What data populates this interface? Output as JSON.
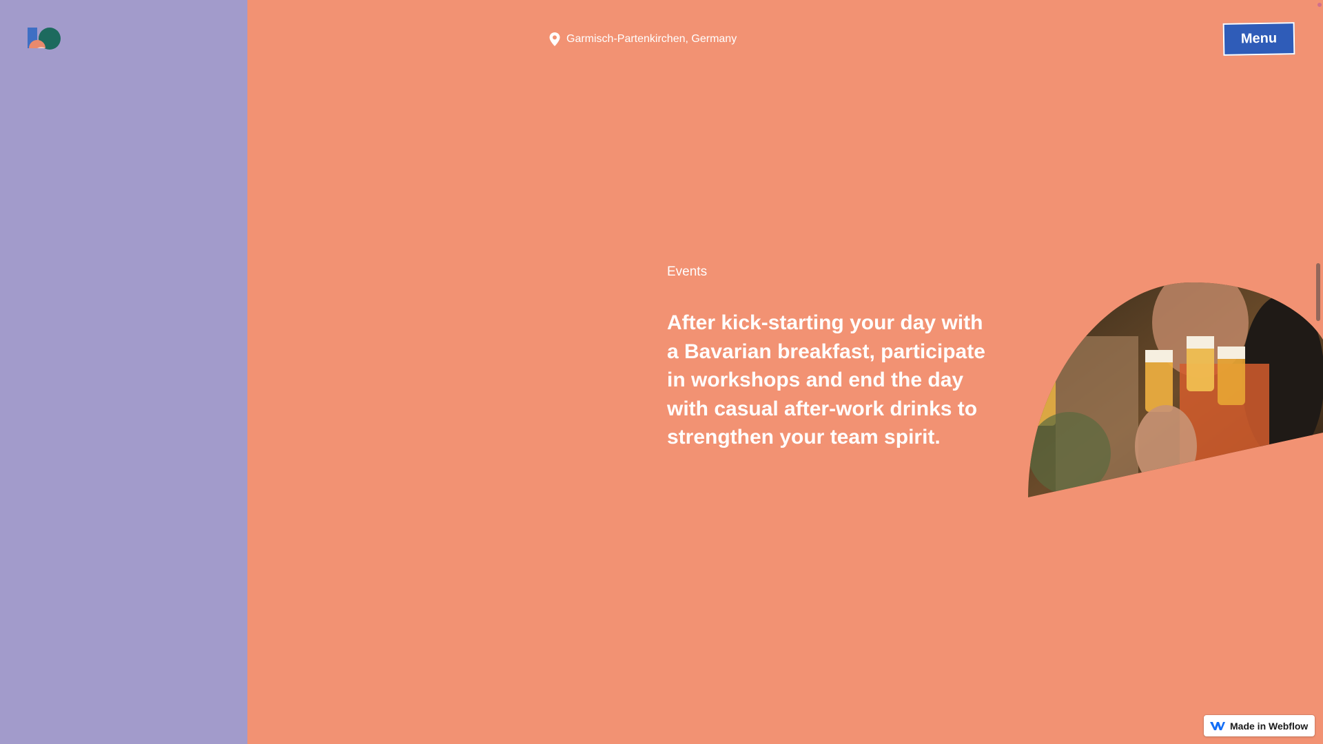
{
  "header": {
    "location_text": "Garmisch-Partenkirchen, Germany",
    "menu_label": "Menu"
  },
  "content": {
    "section_label": "Events",
    "headline": "After kick-starting your day with a Bavarian breakfast, participate in workshops and end the day with casual after-work drinks to strengthen your team spirit."
  },
  "badge": {
    "label": "Made in Webflow"
  },
  "icons": {
    "logo": "logo-icon",
    "location": "location-pin-icon",
    "webflow": "webflow-logo-icon"
  },
  "colors": {
    "left_panel": "#a29bcb",
    "main_panel": "#f29273",
    "menu_button": "#2f5cb8"
  }
}
